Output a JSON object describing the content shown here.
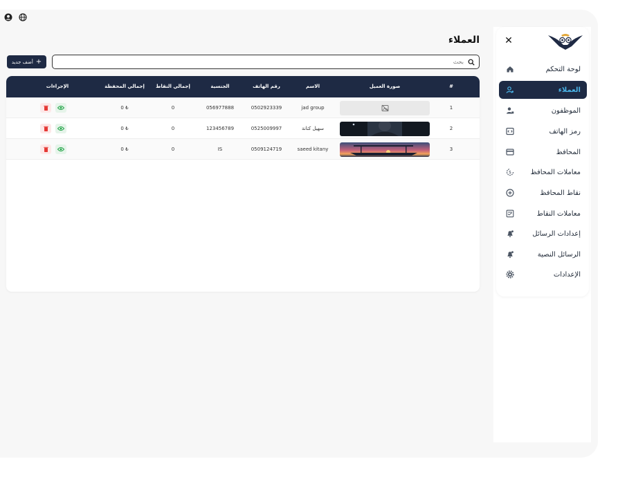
{
  "page": {
    "title": "العملاء"
  },
  "topbar": {
    "icons": [
      "user-circle-icon",
      "globe-icon"
    ]
  },
  "sidebar": {
    "items": [
      {
        "label": "لوحة التحكم",
        "icon": "home-icon",
        "active": false
      },
      {
        "label": "العملاء",
        "icon": "users-icon",
        "active": true
      },
      {
        "label": "الموظفون",
        "icon": "employee-icon",
        "active": false
      },
      {
        "label": "رمز الهاتف",
        "icon": "code-icon",
        "active": false
      },
      {
        "label": "المحافظ",
        "icon": "wallet-icon",
        "active": false
      },
      {
        "label": "معاملات المحافظ",
        "icon": "money-cycle-icon",
        "active": false
      },
      {
        "label": "نقاط المحافظ",
        "icon": "plus-circle-icon",
        "active": false
      },
      {
        "label": "معاملات النقاط",
        "icon": "checklist-icon",
        "active": false
      },
      {
        "label": "إعدادات الرسائل",
        "icon": "bell-icon",
        "active": false
      },
      {
        "label": "الرسائل النصية",
        "icon": "bell-icon",
        "active": false
      },
      {
        "label": "الإعدادات",
        "icon": "gear-icon",
        "active": false
      }
    ]
  },
  "toolbar": {
    "add_label": "أضف جديد",
    "search_placeholder": "بحث"
  },
  "table": {
    "columns": [
      "#",
      "صورة العميل",
      "الاسم",
      "رقم الهاتف",
      "الجنسية",
      "إجمالي النقاط",
      "إجمالي المحفظة",
      "الإجراءات"
    ],
    "rows": [
      {
        "index": "1",
        "image": "none",
        "name": "jad group",
        "phone": "0502923339",
        "nationality": "056977888",
        "points": "0",
        "wallet": "0 ₺"
      },
      {
        "index": "2",
        "image": "portrait",
        "name": "سهيل كتانة",
        "phone": "0525009997",
        "nationality": "123456789",
        "points": "0",
        "wallet": "0 ₺"
      },
      {
        "index": "3",
        "image": "sunset",
        "name": "saeed kitany",
        "phone": "0509124719",
        "nationality": "IS",
        "points": "0",
        "wallet": "0 ₺"
      }
    ]
  },
  "colors": {
    "primary": "#1e2a44",
    "accent": "#4ab3e6",
    "view": "#22a447",
    "delete": "#e53935"
  }
}
